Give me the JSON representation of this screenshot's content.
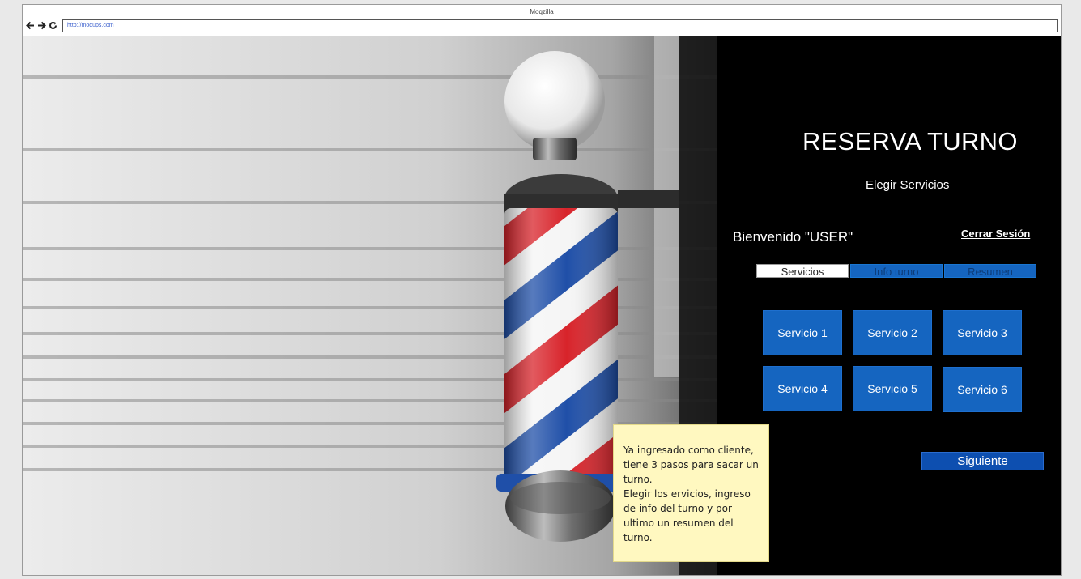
{
  "browser": {
    "title": "Moqzilla",
    "url": "http://moqups.com",
    "nav": {
      "back_icon": "arrow-left-icon",
      "forward_icon": "arrow-right-icon",
      "reload_icon": "reload-icon"
    }
  },
  "panel": {
    "title": "RESERVA TURNO",
    "subtitle": "Elegir Servicios",
    "welcome": "Bienvenido \"USER\"",
    "logout_label": "Cerrar Sesión",
    "steps": [
      {
        "label": "Servicios",
        "active": true
      },
      {
        "label": "Info turno",
        "active": false
      },
      {
        "label": "Resumen",
        "active": false
      }
    ],
    "services": [
      "Servicio 1",
      "Servicio 2",
      "Servicio 3",
      "Servicio 4",
      "Servicio 5",
      "Servicio 6"
    ],
    "next_label": "Siguiente"
  },
  "note": {
    "lines": [
      "Ya ingresado como cliente,",
      "tiene 3 pasos para sacar un",
      "turno.",
      "Elegir los ervicios, ingreso",
      "de info del turno y por",
      "ultimo un resumen del",
      "turno."
    ]
  },
  "colors": {
    "accent": "#1565c0",
    "panel_bg": "#000000",
    "note_bg": "#fff8c0",
    "pole_red": "#d8232a",
    "pole_blue": "#1f4fa8"
  }
}
